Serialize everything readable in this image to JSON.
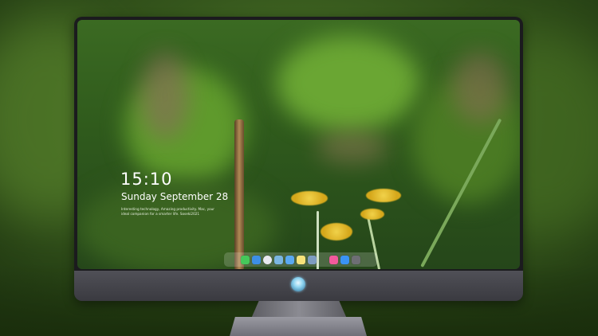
{
  "lockscreen": {
    "time": "15:10",
    "date": "Sunday September 28",
    "tagline": "Interesting technology, Amazing productivity. Mac, your ideal companion for a smarter life. Soseki2021"
  },
  "dock": {
    "items": [
      {
        "name": "messages-icon",
        "color": "#45c75a"
      },
      {
        "name": "finder-icon",
        "color": "#3d8fe6"
      },
      {
        "name": "safari-icon",
        "color": "#e9e9ef"
      },
      {
        "name": "photos-icon",
        "color": "#7bb6e0"
      },
      {
        "name": "video-icon",
        "color": "#5aa9f0"
      },
      {
        "name": "notes-icon",
        "color": "#f6e27a"
      },
      {
        "name": "preview-icon",
        "color": "#7e9cc0"
      },
      {
        "name": "music-icon",
        "color": "#f25a9c"
      },
      {
        "name": "appstore-icon",
        "color": "#3a93f5"
      },
      {
        "name": "camera-icon",
        "color": "#6e6e74"
      }
    ]
  }
}
